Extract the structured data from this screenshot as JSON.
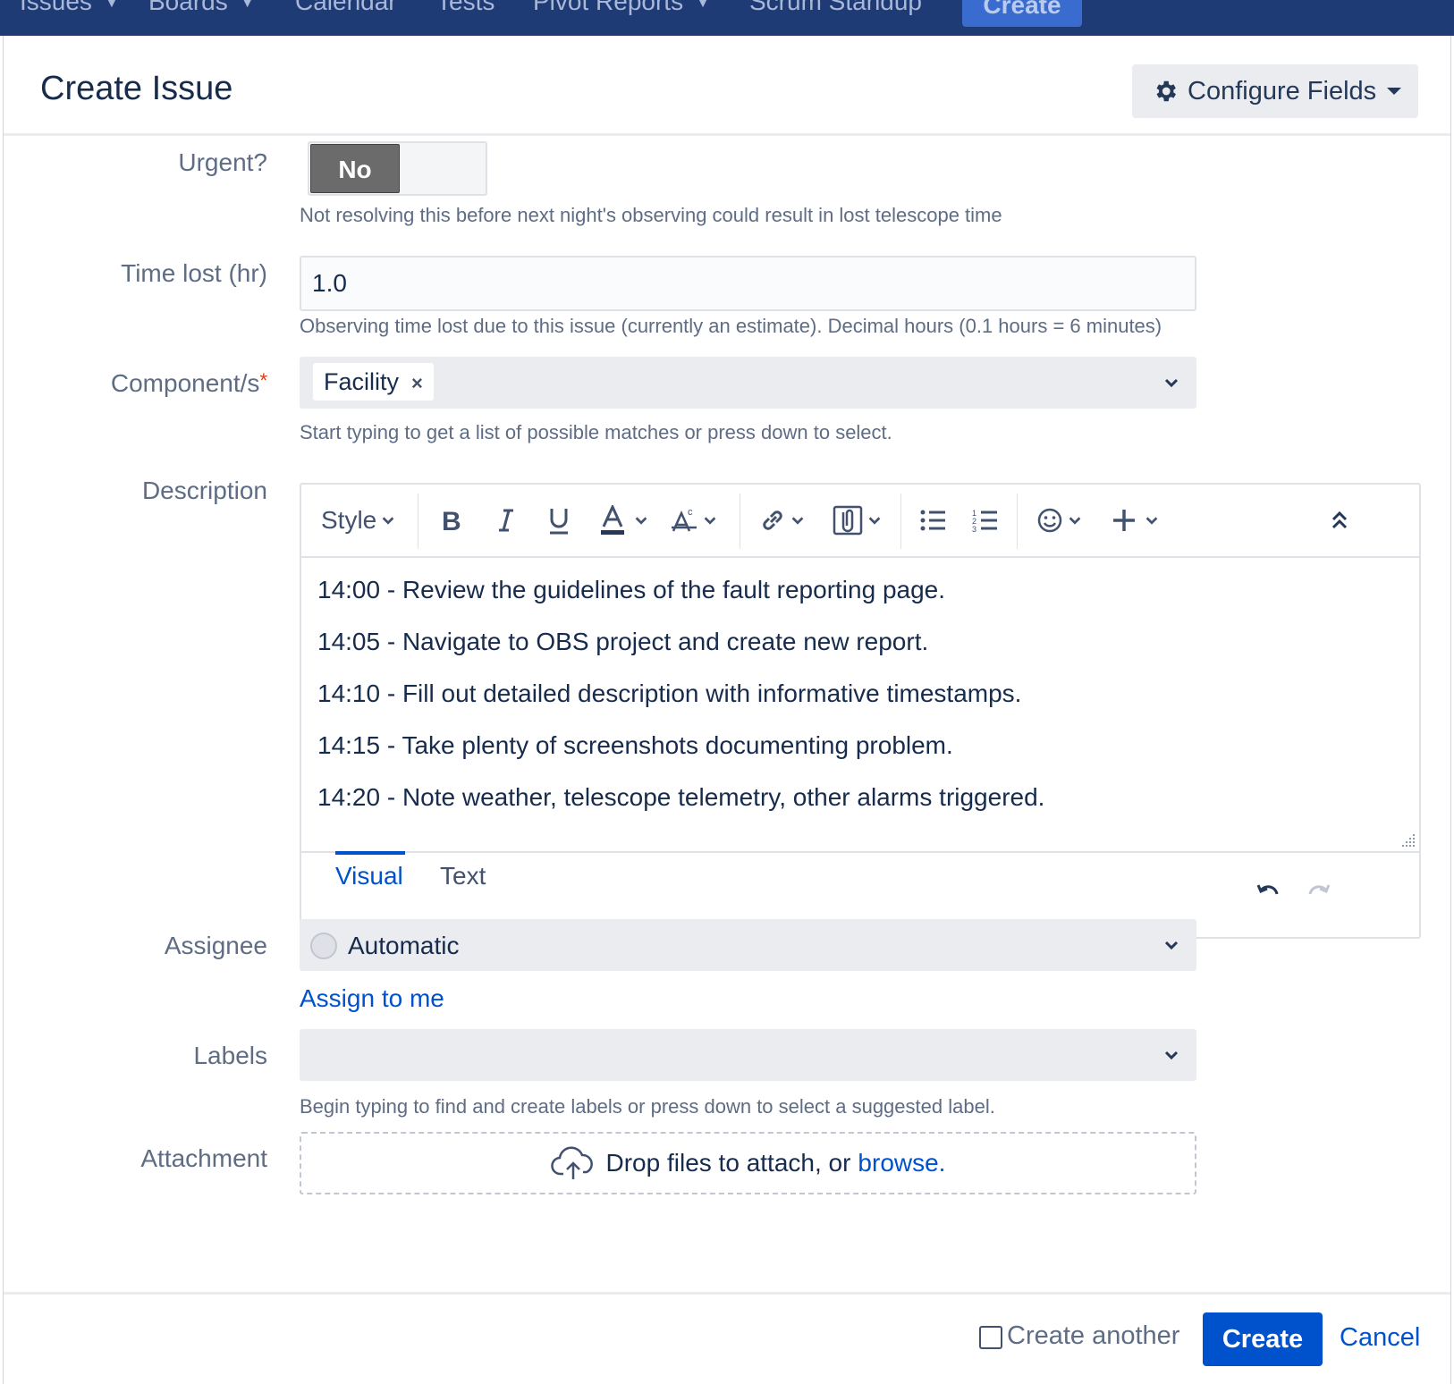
{
  "nav": {
    "items": [
      "Issues",
      "Boards",
      "Calendar",
      "Tests",
      "Pivot Reports",
      "Scrum Standup"
    ],
    "create_label": "Create"
  },
  "dialog": {
    "title": "Create Issue",
    "configure_fields_label": "Configure Fields"
  },
  "fields": {
    "urgent": {
      "label": "Urgent?",
      "value": "No",
      "help": "Not resolving this before next night's observing could result in lost telescope time"
    },
    "time_lost": {
      "label": "Time lost (hr)",
      "value": "1.0",
      "help": "Observing time lost due to this issue (currently an estimate). Decimal hours (0.1 hours = 6 minutes)"
    },
    "components": {
      "label": "Component/s",
      "required_marker": "*",
      "tags": [
        "Facility"
      ],
      "help": "Start typing to get a list of possible matches or press down to select."
    },
    "description": {
      "label": "Description",
      "toolbar": {
        "style_label": "Style"
      },
      "lines": [
        "14:00 - Review the guidelines of the fault reporting page.",
        "14:05 - Navigate to OBS project and create new report.",
        "14:10 - Fill out detailed description with informative timestamps.",
        "14:15 - Take plenty of screenshots documenting problem.",
        "14:20 - Note weather, telescope telemetry, other alarms triggered."
      ],
      "tabs": [
        "Visual",
        "Text"
      ],
      "active_tab": "Visual"
    },
    "assignee": {
      "label": "Assignee",
      "value": "Automatic",
      "assign_to_me": "Assign to me"
    },
    "labels": {
      "label": "Labels",
      "value": "",
      "help": "Begin typing to find and create labels or press down to select a suggested label."
    },
    "attachment": {
      "label": "Attachment",
      "drop_text": "Drop files to attach, or",
      "browse_text": "browse."
    }
  },
  "footer": {
    "create_another_label": "Create another",
    "create_another_checked": false,
    "create_label": "Create",
    "cancel_label": "Cancel"
  },
  "colors": {
    "nav_bg": "#1f3b75",
    "primary": "#0052cc",
    "required": "#de350b",
    "field_bg": "#ebecf0"
  }
}
